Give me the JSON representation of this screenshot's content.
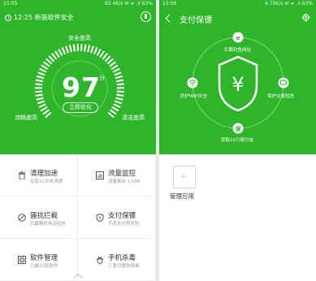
{
  "left": {
    "status": {
      "time": "15:05",
      "right": "93.4K/s ✉ ᯤ .ıl 63%"
    },
    "notice": "12:25 新装软件安全",
    "score": "97",
    "score_unit": "分",
    "optimize_label": "立即优化",
    "gauge_labels": {
      "top": "安全度高",
      "left": "流畅度高",
      "right": "清洁度高"
    },
    "features": [
      {
        "name": "清理加速",
        "desc": "垃圾12天未清理",
        "icon": "trash-icon"
      },
      {
        "name": "流量监控",
        "desc": "流量剩余 110M",
        "icon": "bar-chart-icon"
      },
      {
        "name": "骚扰拦截",
        "desc": "拦截骚扰电话短信",
        "icon": "block-icon"
      },
      {
        "name": "支付保镖",
        "desc": "手机支付零风险",
        "icon": "shield-icon"
      },
      {
        "name": "软件管理",
        "desc": "已装21款软件",
        "icon": "apps-icon"
      },
      {
        "name": "手机杀毒",
        "desc": "三重引擎防病毒",
        "icon": "bug-icon"
      }
    ]
  },
  "right": {
    "status": {
      "time": "15:06",
      "right": "4.79K/s ✉ ᯤ .ıl 63%"
    },
    "title": "支付保镖",
    "nodes": {
      "top": "拦截钓鱼网址",
      "left": "防护WiFi安全",
      "right": "保护交易短信",
      "bottom": "获取10万赔付金"
    },
    "app_label": "管理应用",
    "app_icon_glyph": "+"
  },
  "colors": {
    "green": "#2fb52b",
    "white": "#ffffff"
  }
}
